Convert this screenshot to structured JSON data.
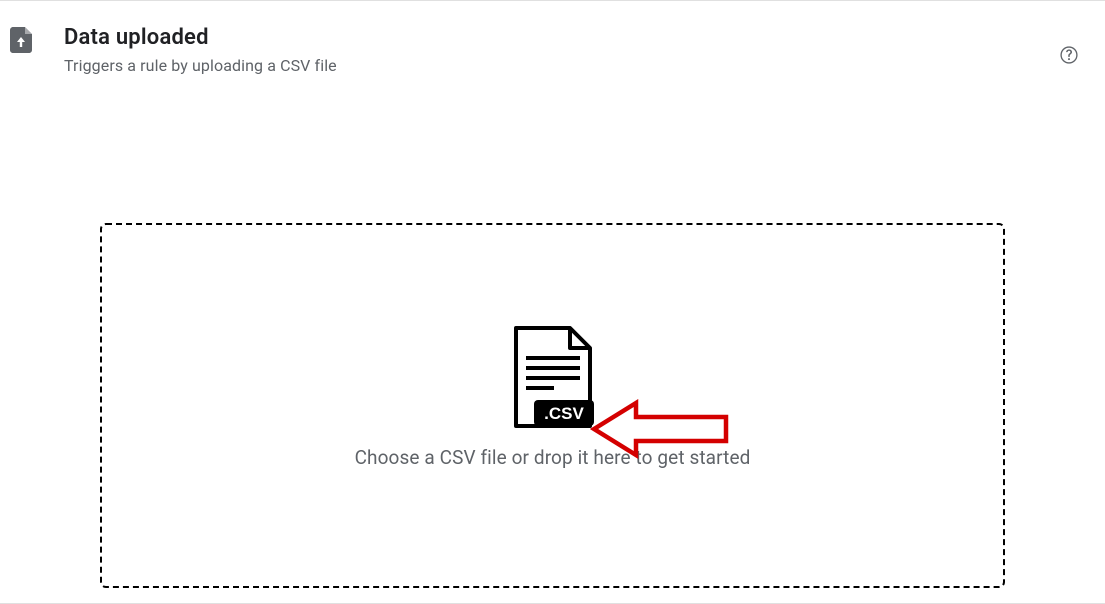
{
  "header": {
    "title": "Data uploaded",
    "subtitle": "Triggers a rule by uploading a CSV file"
  },
  "dropzone": {
    "instruction": "Choose a CSV file or drop it here to get started",
    "icon_label": ".CSV"
  }
}
